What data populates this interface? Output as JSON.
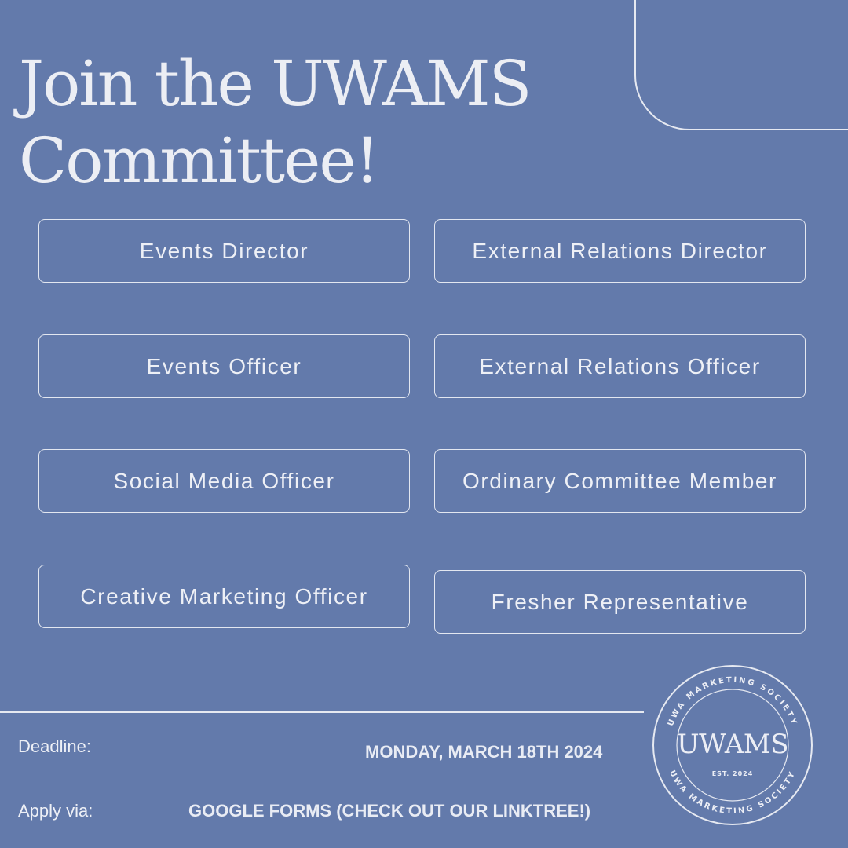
{
  "title": {
    "line1": "Join the UWAMS",
    "line2": "Committee!"
  },
  "roles": [
    "Events Director",
    "External Relations Director",
    "Events Officer",
    "External Relations Officer",
    "Social Media Officer",
    "Ordinary Committee Member",
    "Creative Marketing Officer",
    "Fresher Representative"
  ],
  "info": {
    "deadline_label": "Deadline:",
    "deadline_value": "MONDAY, MARCH 18TH 2024",
    "apply_label": "Apply via:",
    "apply_value": "GOOGLE FORMS (CHECK OUT OUR LINKTREE!)"
  },
  "logo": {
    "ring_text_top": "UWA MARKETING SOCIETY",
    "ring_text_bottom": "UWA MARKETING SOCIETY",
    "wordmark": "UWAMS",
    "est": "EST. 2024"
  },
  "colors": {
    "background": "#637aab",
    "foreground": "#eceef5"
  }
}
